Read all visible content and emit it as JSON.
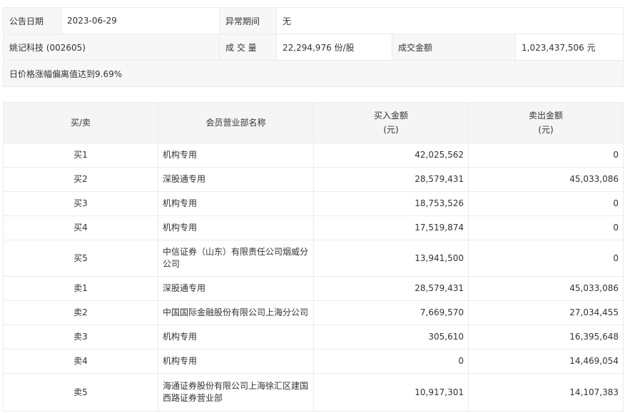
{
  "info": {
    "date_label": "公告日期",
    "date_value": "2023-06-29",
    "abnormal_label": "异常期间",
    "abnormal_value": "无",
    "stock_name": "姚记科技 (002605)",
    "volume_label": "成 交 量",
    "volume_value": "22,294,976 份/股",
    "amount_label": "成交金额",
    "amount_value": "1,023,437,506 元",
    "reason": "日价格涨幅偏离值达到9.69%"
  },
  "table": {
    "headers": {
      "side": "买/卖",
      "dept": "会员营业部名称",
      "buy_line1": "买入金额",
      "buy_line2": "(元)",
      "sell_line1": "卖出金额",
      "sell_line2": "(元)"
    },
    "rows": [
      {
        "side": "买1",
        "dept": "机构专用",
        "buy": "42,025,562",
        "sell": "0"
      },
      {
        "side": "买2",
        "dept": "深股通专用",
        "buy": "28,579,431",
        "sell": "45,033,086"
      },
      {
        "side": "买3",
        "dept": "机构专用",
        "buy": "18,753,526",
        "sell": "0"
      },
      {
        "side": "买4",
        "dept": "机构专用",
        "buy": "17,519,874",
        "sell": "0"
      },
      {
        "side": "买5",
        "dept": "中信证券（山东）有限责任公司烟威分公司",
        "buy": "13,941,500",
        "sell": "0"
      },
      {
        "side": "卖1",
        "dept": "深股通专用",
        "buy": "28,579,431",
        "sell": "45,033,086"
      },
      {
        "side": "卖2",
        "dept": "中国国际金融股份有限公司上海分公司",
        "buy": "7,669,570",
        "sell": "27,034,455"
      },
      {
        "side": "卖3",
        "dept": "机构专用",
        "buy": "305,610",
        "sell": "16,395,648"
      },
      {
        "side": "卖4",
        "dept": "机构专用",
        "buy": "0",
        "sell": "14,469,054"
      },
      {
        "side": "卖5",
        "dept": "海通证券股份有限公司上海徐汇区建国西路证券营业部",
        "buy": "10,917,301",
        "sell": "14,107,383"
      }
    ]
  }
}
